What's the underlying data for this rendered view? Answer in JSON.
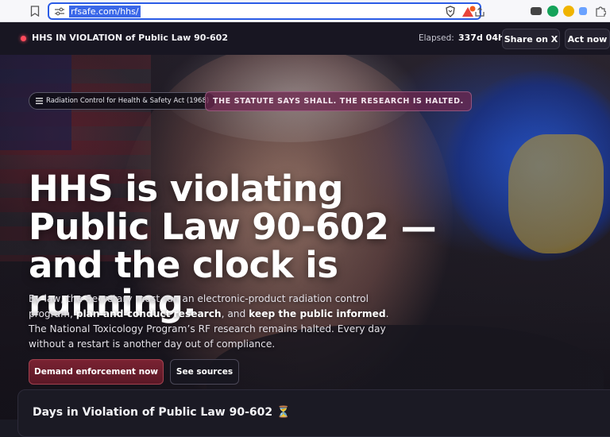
{
  "browser": {
    "url": "rfsafe.com/hhs/"
  },
  "topbar": {
    "title": "HHS IN VIOLATION of Public Law 90-602",
    "elapsed_label": "Elapsed:",
    "elapsed_value": "337d 04h",
    "share_label": "Share on X",
    "act_label": "Act now"
  },
  "hero": {
    "chip_act": "Radiation Control for Health & Safety Act (1968)",
    "chip_shall": "THE STATUTE SAYS SHALL. THE RESEARCH IS HALTED.",
    "headline": "HHS is violating Public Law 90-602 — and the clock is running.",
    "body": {
      "p1": "By law, the Secretary must run an electronic-product radiation control program, ",
      "b1": "plan and conduct research",
      "p2": ", and ",
      "b2": "keep the public informed",
      "p3": ". The National Toxicology Program’s RF research remains halted. Every day without a restart is another day out of compliance."
    },
    "cta_primary": "Demand enforcement now",
    "cta_secondary": "See sources"
  },
  "panel": {
    "title": "Days in Violation of Public Law 90-602 ⏳"
  },
  "colors": {
    "accent": "#2b5ce6",
    "alert": "#ff4b5c",
    "primary_button": "#6b1d2c"
  }
}
